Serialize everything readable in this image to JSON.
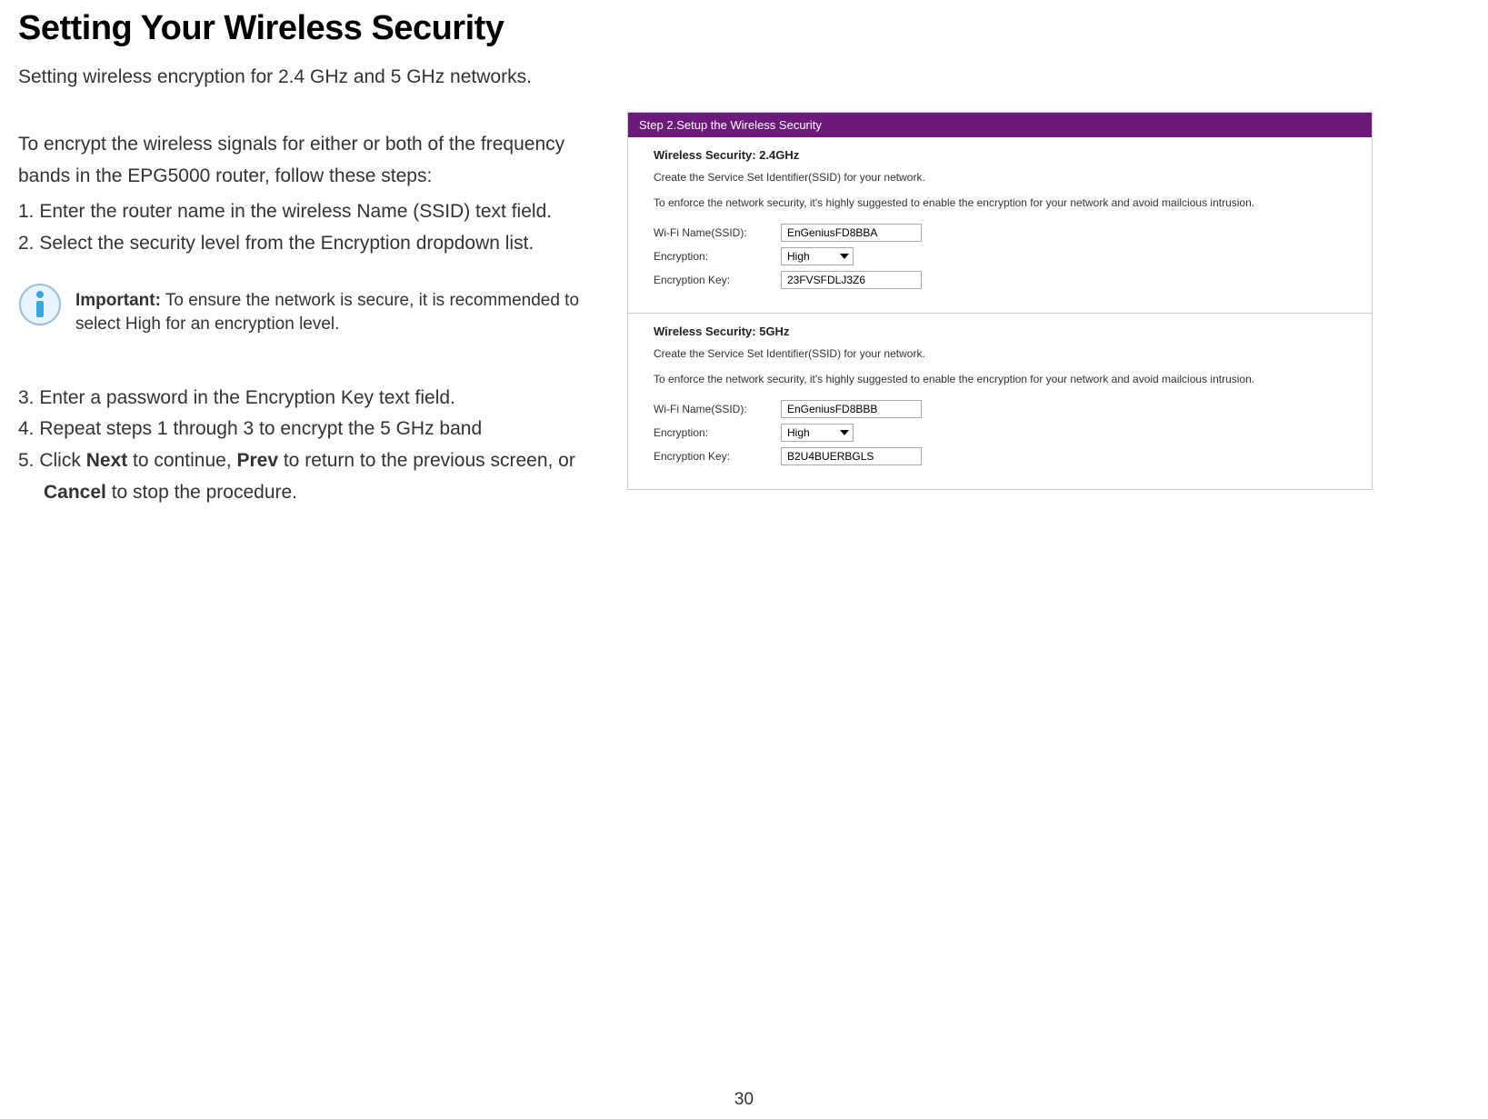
{
  "title": "Setting Your Wireless Security",
  "subtitle": "Setting wireless encryption for 2.4 GHz and 5 GHz networks.",
  "intro": "To encrypt the wireless signals for either or both of the frequency bands in the EPG5000 router, follow these steps:",
  "step1": "1. Enter the router name in the wireless Name (SSID) text field.",
  "step2": "2. Select the security level from the Encryption dropdown list.",
  "important_label": "Important:",
  "important_text": " To ensure the network is secure, it is recommended to select High for an encryption level.",
  "step3": "3. Enter a password in the Encryption Key text field.",
  "step4": "4. Repeat steps 1 through 3 to encrypt the 5 GHz band",
  "step5_pre": "5. Click ",
  "step5_next": "Next",
  "step5_mid1": " to continue, ",
  "step5_prev": "Prev",
  "step5_mid2": " to return to the previous screen, or ",
  "step5_cancel": "Cancel",
  "step5_end": " to stop the procedure.",
  "page_num": "30",
  "panel": {
    "header": "Step 2.Setup the Wireless Security",
    "band24": {
      "title": "Wireless Security: 2.4GHz",
      "sub": "Create the Service Set Identifier(SSID) for your network.",
      "note": "To enforce the network security, it's highly suggested to enable the encryption for your network and avoid mailcious intrusion.",
      "ssid_label": "Wi-Fi Name(SSID):",
      "ssid_value": "EnGeniusFD8BBA",
      "enc_label": "Encryption:",
      "enc_value": "High",
      "key_label": "Encryption Key:",
      "key_value": "23FVSFDLJ3Z6"
    },
    "band5": {
      "title": "Wireless Security: 5GHz",
      "sub": "Create the Service Set Identifier(SSID) for your network.",
      "note": "To enforce the network security, it's highly suggested to enable the encryption for your network and avoid mailcious intrusion.",
      "ssid_label": "Wi-Fi Name(SSID):",
      "ssid_value": "EnGeniusFD8BBB",
      "enc_label": "Encryption:",
      "enc_value": "High",
      "key_label": "Encryption Key:",
      "key_value": "B2U4BUERBGLS"
    }
  }
}
